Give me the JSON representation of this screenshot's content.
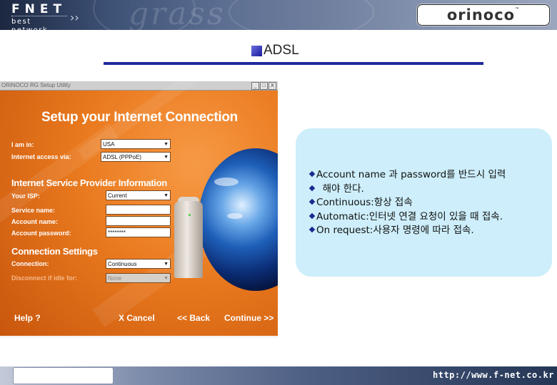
{
  "header": {
    "brand_main": "FNET",
    "brand_tag": "best network",
    "brand_arrow": "››",
    "partner_logo": "orinoco",
    "partner_tm": "™"
  },
  "title": "ADSL",
  "wizard": {
    "window_title": "ORiNOCO RG Setup Utility",
    "window_buttons": [
      "_",
      "□",
      "X"
    ],
    "heading": "Setup your Internet Connection",
    "fields": {
      "location_label": "I am in:",
      "location_value": "USA",
      "access_label": "Internet access via:",
      "access_value": "ADSL (PPPoE)"
    },
    "isp_section": {
      "title": "Internet Service Provider Information",
      "isp_label": "Your ISP:",
      "isp_value": "Current",
      "service_label": "Service name:",
      "service_value": "",
      "account_label": "Account name:",
      "account_value": "",
      "password_label": "Account password:",
      "password_value": "********"
    },
    "conn_section": {
      "title": "Connection Settings",
      "connection_label": "Connection:",
      "connection_value": "Continuous",
      "disconnect_label": "Disconnect if idle for:",
      "disconnect_value": "None"
    },
    "buttons": {
      "help": "Help ?",
      "cancel": "X Cancel",
      "back": "<< Back",
      "continue": "Continue >>"
    }
  },
  "notes": [
    "Account name 과 password를 반드시 입력",
    "  해야 한다.",
    "Continuous:항상 접속",
    "Automatic:인터넷 연결 요청이 있을 때 접속.",
    "On request:사용자 명령에 따라 접속."
  ],
  "footer": {
    "url": "http://www.f-net.co.kr"
  },
  "colors": {
    "title_rule": "#1f2a9a",
    "info_box": "#cdeefa",
    "wizard_orange": "#f3862a"
  }
}
